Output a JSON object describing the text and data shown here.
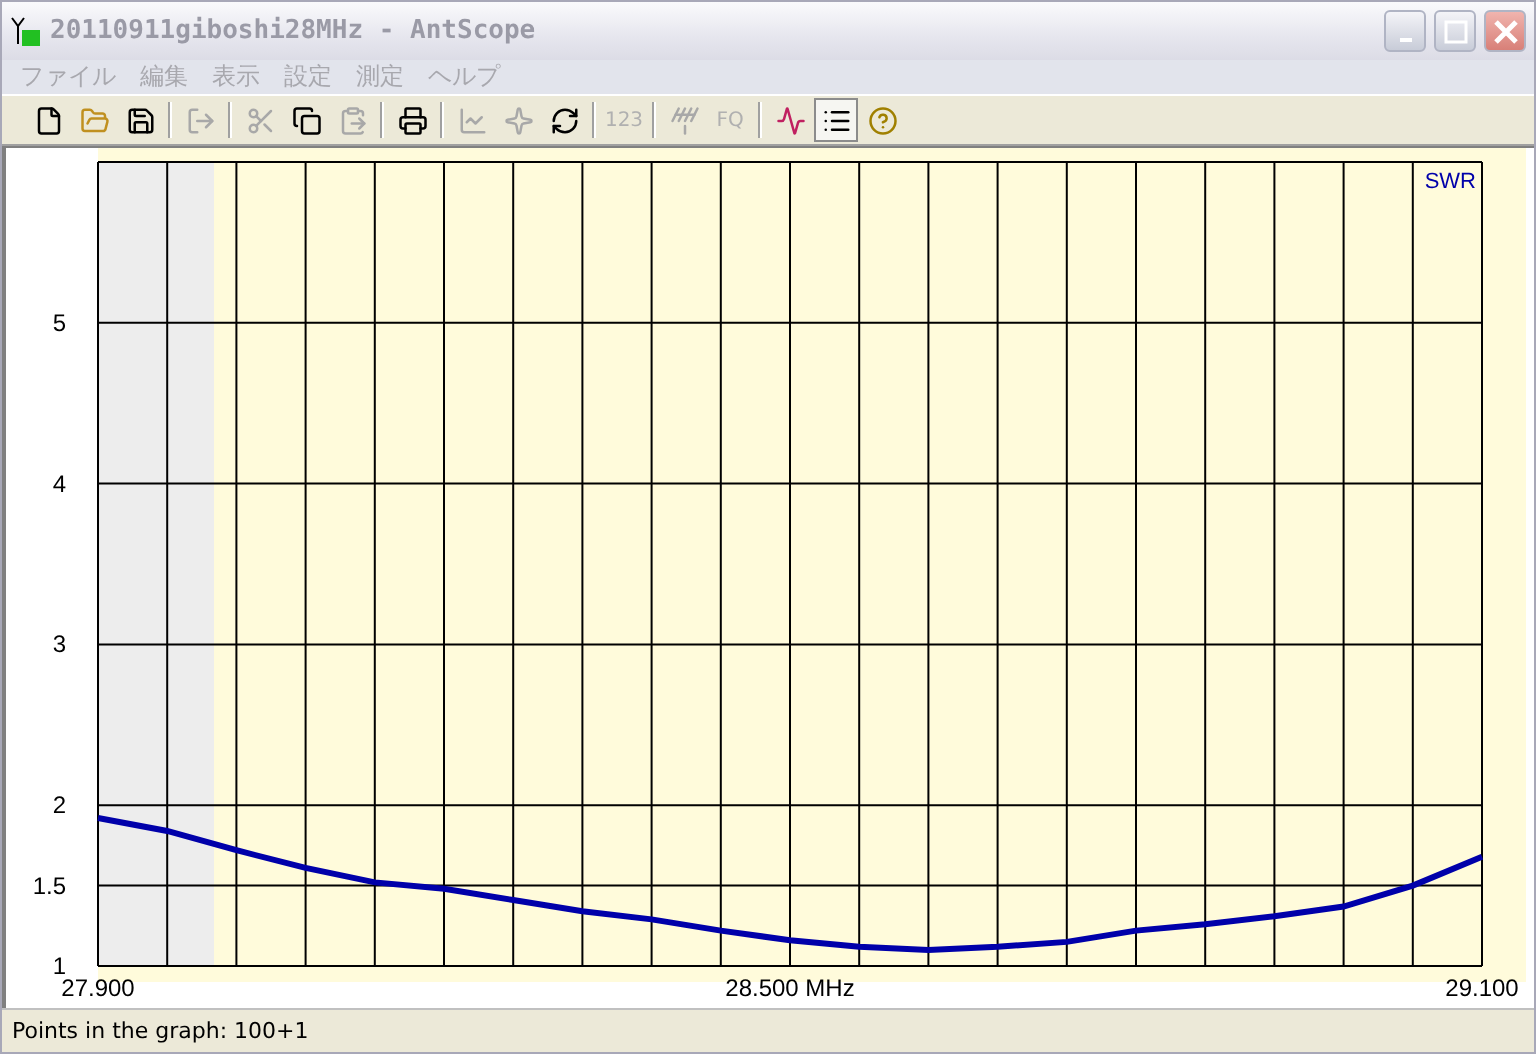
{
  "window": {
    "title": "20110911giboshi28MHz - AntScope"
  },
  "menu": [
    "ファイル",
    "編集",
    "表示",
    "設定",
    "測定",
    "ヘルプ"
  ],
  "toolbar": [
    {
      "kind": "new",
      "disabled": false,
      "pressed": false
    },
    {
      "kind": "open",
      "disabled": false,
      "pressed": false
    },
    {
      "kind": "save",
      "disabled": false,
      "pressed": false
    },
    {
      "kind": "separator"
    },
    {
      "kind": "export",
      "disabled": true,
      "pressed": false
    },
    {
      "kind": "separator"
    },
    {
      "kind": "cut",
      "disabled": true,
      "pressed": false
    },
    {
      "kind": "copy",
      "disabled": false,
      "pressed": false
    },
    {
      "kind": "paste",
      "disabled": true,
      "pressed": false
    },
    {
      "kind": "separator"
    },
    {
      "kind": "print",
      "disabled": false,
      "pressed": false
    },
    {
      "kind": "separator"
    },
    {
      "kind": "graph",
      "disabled": true,
      "pressed": false
    },
    {
      "kind": "star",
      "disabled": true,
      "pressed": false
    },
    {
      "kind": "refresh",
      "disabled": false,
      "pressed": false
    },
    {
      "kind": "separator"
    },
    {
      "kind": "text",
      "label": "123",
      "disabled": true,
      "pressed": false
    },
    {
      "kind": "separator"
    },
    {
      "kind": "antenna",
      "disabled": true,
      "pressed": false
    },
    {
      "kind": "text",
      "label": "FQ",
      "disabled": true,
      "pressed": false
    },
    {
      "kind": "separator"
    },
    {
      "kind": "curves",
      "disabled": false,
      "pressed": false
    },
    {
      "kind": "list",
      "disabled": false,
      "pressed": true
    },
    {
      "kind": "help",
      "disabled": false,
      "pressed": false
    }
  ],
  "chart": {
    "chart_data": {
      "type": "line",
      "xlim": [
        27.9,
        29.1
      ],
      "ylim": [
        1,
        6
      ],
      "grid": true,
      "xticks": [
        {
          "value": 27.9,
          "label": "27.900"
        },
        {
          "value": 28.5,
          "label": "28.500 MHz"
        },
        {
          "value": 29.1,
          "label": "29.100"
        }
      ],
      "yticks": [
        {
          "value": 1,
          "label": "1"
        },
        {
          "value": 1.5,
          "label": "1.5"
        },
        {
          "value": 2,
          "label": "2"
        },
        {
          "value": 3,
          "label": "3"
        },
        {
          "value": 4,
          "label": "4"
        },
        {
          "value": 5,
          "label": "5"
        }
      ],
      "x": [
        27.9,
        27.96,
        28.02,
        28.08,
        28.14,
        28.2,
        28.26,
        28.32,
        28.38,
        28.44,
        28.5,
        28.56,
        28.62,
        28.68,
        28.74,
        28.8,
        28.86,
        28.92,
        28.98,
        29.04,
        29.1
      ],
      "series": [
        {
          "name": "SWR",
          "color": "#0000aa",
          "values": [
            1.92,
            1.84,
            1.72,
            1.61,
            1.52,
            1.48,
            1.41,
            1.34,
            1.29,
            1.22,
            1.16,
            1.12,
            1.1,
            1.12,
            1.15,
            1.22,
            1.26,
            1.31,
            1.37,
            1.5,
            1.68
          ]
        }
      ]
    }
  },
  "status_bar": "Points in the graph: 100+1"
}
